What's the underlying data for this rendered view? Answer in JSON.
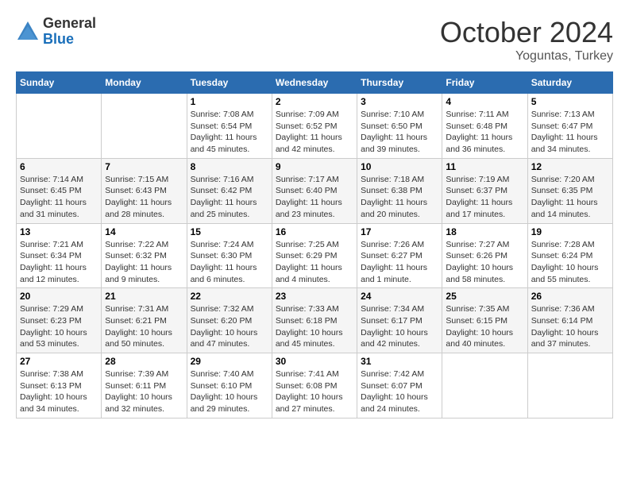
{
  "header": {
    "logo_general": "General",
    "logo_blue": "Blue",
    "month_title": "October 2024",
    "location": "Yoguntas, Turkey"
  },
  "weekdays": [
    "Sunday",
    "Monday",
    "Tuesday",
    "Wednesday",
    "Thursday",
    "Friday",
    "Saturday"
  ],
  "weeks": [
    [
      {
        "day": "",
        "sunrise": "",
        "sunset": "",
        "daylight": ""
      },
      {
        "day": "",
        "sunrise": "",
        "sunset": "",
        "daylight": ""
      },
      {
        "day": "1",
        "sunrise": "Sunrise: 7:08 AM",
        "sunset": "Sunset: 6:54 PM",
        "daylight": "Daylight: 11 hours and 45 minutes."
      },
      {
        "day": "2",
        "sunrise": "Sunrise: 7:09 AM",
        "sunset": "Sunset: 6:52 PM",
        "daylight": "Daylight: 11 hours and 42 minutes."
      },
      {
        "day": "3",
        "sunrise": "Sunrise: 7:10 AM",
        "sunset": "Sunset: 6:50 PM",
        "daylight": "Daylight: 11 hours and 39 minutes."
      },
      {
        "day": "4",
        "sunrise": "Sunrise: 7:11 AM",
        "sunset": "Sunset: 6:48 PM",
        "daylight": "Daylight: 11 hours and 36 minutes."
      },
      {
        "day": "5",
        "sunrise": "Sunrise: 7:13 AM",
        "sunset": "Sunset: 6:47 PM",
        "daylight": "Daylight: 11 hours and 34 minutes."
      }
    ],
    [
      {
        "day": "6",
        "sunrise": "Sunrise: 7:14 AM",
        "sunset": "Sunset: 6:45 PM",
        "daylight": "Daylight: 11 hours and 31 minutes."
      },
      {
        "day": "7",
        "sunrise": "Sunrise: 7:15 AM",
        "sunset": "Sunset: 6:43 PM",
        "daylight": "Daylight: 11 hours and 28 minutes."
      },
      {
        "day": "8",
        "sunrise": "Sunrise: 7:16 AM",
        "sunset": "Sunset: 6:42 PM",
        "daylight": "Daylight: 11 hours and 25 minutes."
      },
      {
        "day": "9",
        "sunrise": "Sunrise: 7:17 AM",
        "sunset": "Sunset: 6:40 PM",
        "daylight": "Daylight: 11 hours and 23 minutes."
      },
      {
        "day": "10",
        "sunrise": "Sunrise: 7:18 AM",
        "sunset": "Sunset: 6:38 PM",
        "daylight": "Daylight: 11 hours and 20 minutes."
      },
      {
        "day": "11",
        "sunrise": "Sunrise: 7:19 AM",
        "sunset": "Sunset: 6:37 PM",
        "daylight": "Daylight: 11 hours and 17 minutes."
      },
      {
        "day": "12",
        "sunrise": "Sunrise: 7:20 AM",
        "sunset": "Sunset: 6:35 PM",
        "daylight": "Daylight: 11 hours and 14 minutes."
      }
    ],
    [
      {
        "day": "13",
        "sunrise": "Sunrise: 7:21 AM",
        "sunset": "Sunset: 6:34 PM",
        "daylight": "Daylight: 11 hours and 12 minutes."
      },
      {
        "day": "14",
        "sunrise": "Sunrise: 7:22 AM",
        "sunset": "Sunset: 6:32 PM",
        "daylight": "Daylight: 11 hours and 9 minutes."
      },
      {
        "day": "15",
        "sunrise": "Sunrise: 7:24 AM",
        "sunset": "Sunset: 6:30 PM",
        "daylight": "Daylight: 11 hours and 6 minutes."
      },
      {
        "day": "16",
        "sunrise": "Sunrise: 7:25 AM",
        "sunset": "Sunset: 6:29 PM",
        "daylight": "Daylight: 11 hours and 4 minutes."
      },
      {
        "day": "17",
        "sunrise": "Sunrise: 7:26 AM",
        "sunset": "Sunset: 6:27 PM",
        "daylight": "Daylight: 11 hours and 1 minute."
      },
      {
        "day": "18",
        "sunrise": "Sunrise: 7:27 AM",
        "sunset": "Sunset: 6:26 PM",
        "daylight": "Daylight: 10 hours and 58 minutes."
      },
      {
        "day": "19",
        "sunrise": "Sunrise: 7:28 AM",
        "sunset": "Sunset: 6:24 PM",
        "daylight": "Daylight: 10 hours and 55 minutes."
      }
    ],
    [
      {
        "day": "20",
        "sunrise": "Sunrise: 7:29 AM",
        "sunset": "Sunset: 6:23 PM",
        "daylight": "Daylight: 10 hours and 53 minutes."
      },
      {
        "day": "21",
        "sunrise": "Sunrise: 7:31 AM",
        "sunset": "Sunset: 6:21 PM",
        "daylight": "Daylight: 10 hours and 50 minutes."
      },
      {
        "day": "22",
        "sunrise": "Sunrise: 7:32 AM",
        "sunset": "Sunset: 6:20 PM",
        "daylight": "Daylight: 10 hours and 47 minutes."
      },
      {
        "day": "23",
        "sunrise": "Sunrise: 7:33 AM",
        "sunset": "Sunset: 6:18 PM",
        "daylight": "Daylight: 10 hours and 45 minutes."
      },
      {
        "day": "24",
        "sunrise": "Sunrise: 7:34 AM",
        "sunset": "Sunset: 6:17 PM",
        "daylight": "Daylight: 10 hours and 42 minutes."
      },
      {
        "day": "25",
        "sunrise": "Sunrise: 7:35 AM",
        "sunset": "Sunset: 6:15 PM",
        "daylight": "Daylight: 10 hours and 40 minutes."
      },
      {
        "day": "26",
        "sunrise": "Sunrise: 7:36 AM",
        "sunset": "Sunset: 6:14 PM",
        "daylight": "Daylight: 10 hours and 37 minutes."
      }
    ],
    [
      {
        "day": "27",
        "sunrise": "Sunrise: 7:38 AM",
        "sunset": "Sunset: 6:13 PM",
        "daylight": "Daylight: 10 hours and 34 minutes."
      },
      {
        "day": "28",
        "sunrise": "Sunrise: 7:39 AM",
        "sunset": "Sunset: 6:11 PM",
        "daylight": "Daylight: 10 hours and 32 minutes."
      },
      {
        "day": "29",
        "sunrise": "Sunrise: 7:40 AM",
        "sunset": "Sunset: 6:10 PM",
        "daylight": "Daylight: 10 hours and 29 minutes."
      },
      {
        "day": "30",
        "sunrise": "Sunrise: 7:41 AM",
        "sunset": "Sunset: 6:08 PM",
        "daylight": "Daylight: 10 hours and 27 minutes."
      },
      {
        "day": "31",
        "sunrise": "Sunrise: 7:42 AM",
        "sunset": "Sunset: 6:07 PM",
        "daylight": "Daylight: 10 hours and 24 minutes."
      },
      {
        "day": "",
        "sunrise": "",
        "sunset": "",
        "daylight": ""
      },
      {
        "day": "",
        "sunrise": "",
        "sunset": "",
        "daylight": ""
      }
    ]
  ]
}
